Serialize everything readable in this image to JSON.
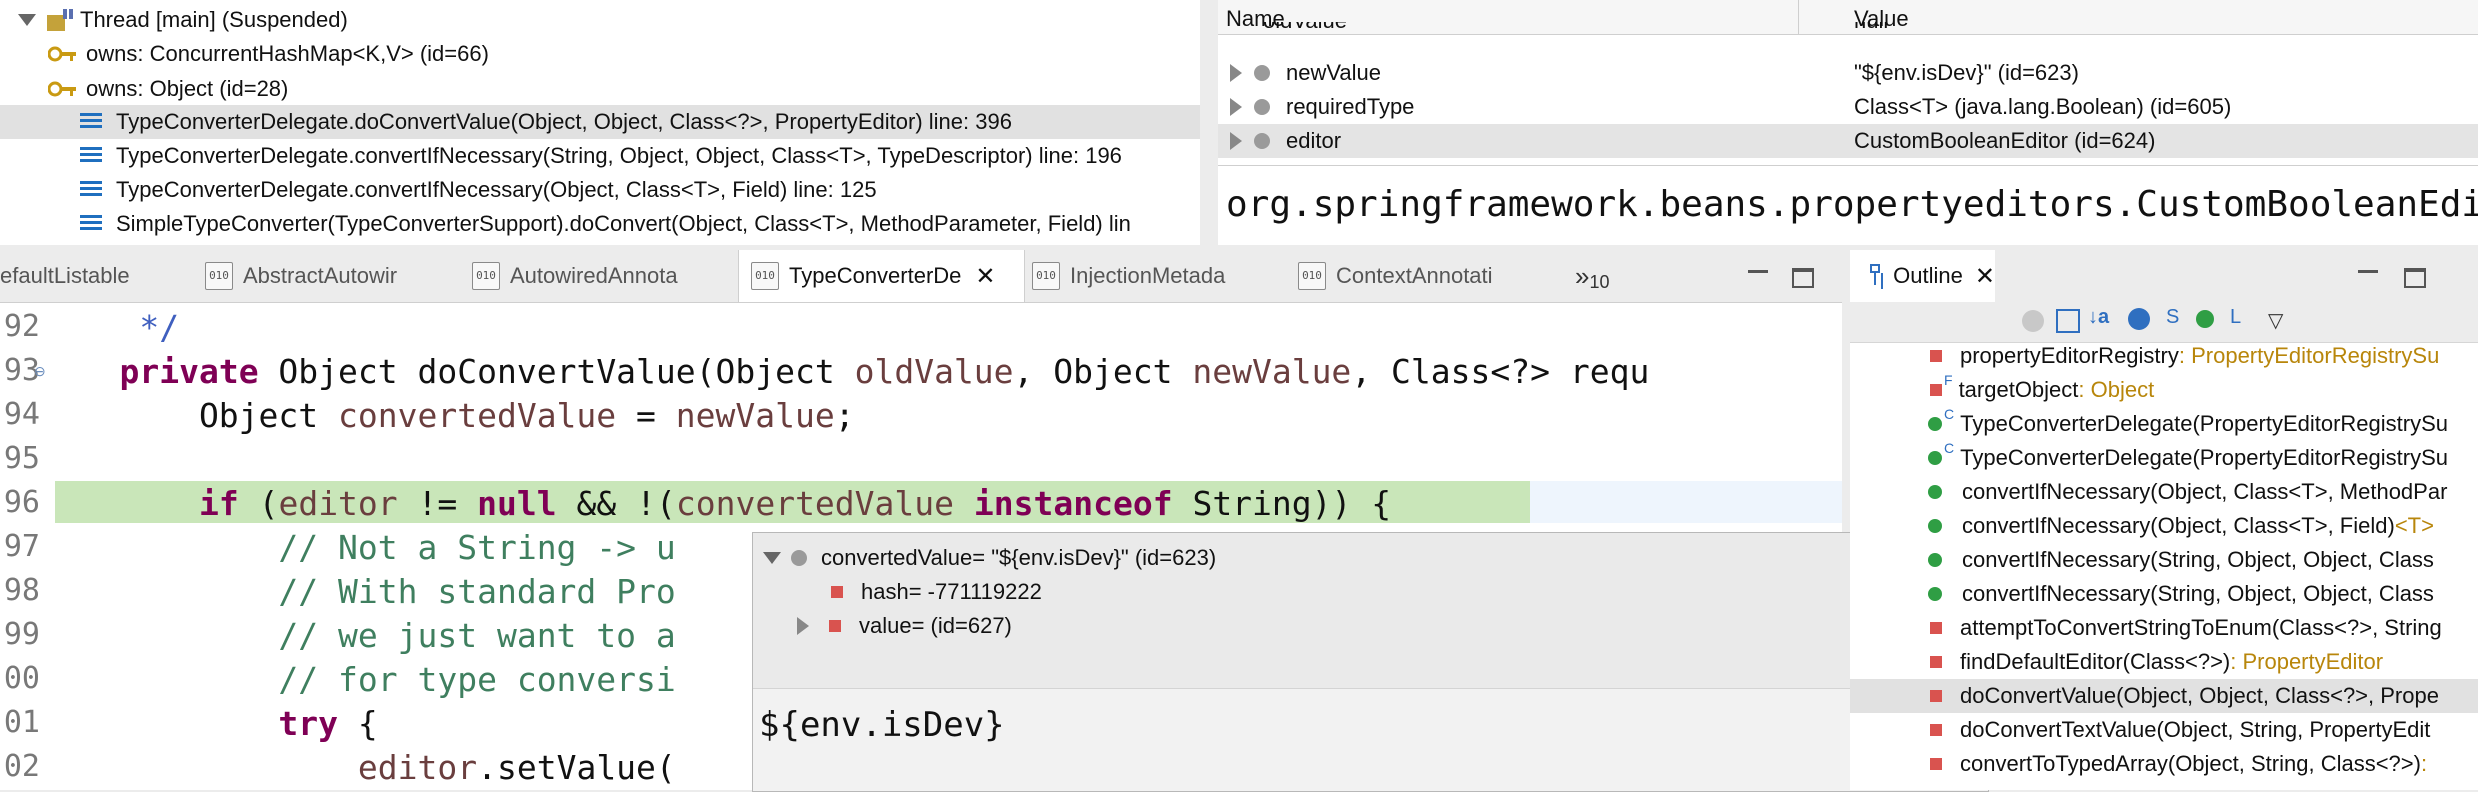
{
  "debug": {
    "thread": "Thread [main] (Suspended)",
    "locks": [
      "owns: ConcurrentHashMap<K,V>  (id=66)",
      "owns: Object  (id=28)"
    ],
    "frames": [
      "TypeConverterDelegate.doConvertValue(Object, Object, Class<?>, PropertyEditor) line: 396",
      "TypeConverterDelegate.convertIfNecessary(String, Object, Object, Class<T>, TypeDescriptor) line: 196",
      "TypeConverterDelegate.convertIfNecessary(Object, Class<T>, Field) line: 125",
      "SimpleTypeConverter(TypeConverterSupport).doConvert(Object, Class<T>, MethodParameter, Field) lin"
    ]
  },
  "variables": {
    "col_name": "Name",
    "col_value": "Value",
    "rows": [
      {
        "name": "oldValue",
        "value": "null"
      },
      {
        "name": "newValue",
        "value": "\"${env.isDev}\" (id=623)"
      },
      {
        "name": "requiredType",
        "value": "Class<T> (java.lang.Boolean) (id=605)"
      },
      {
        "name": "editor",
        "value": "CustomBooleanEditor  (id=624)"
      }
    ],
    "detail": "org.springframework.beans.propertyeditors.CustomBooleanEdi"
  },
  "tabs": {
    "items": [
      "efaultListable",
      "AbstractAutowir",
      "AutowiredAnnota",
      "TypeConverterDe",
      "InjectionMetada",
      "ContextAnnotati"
    ],
    "overflow": "10"
  },
  "editor": {
    "lines": [
      {
        "n": "92",
        "text": "     */"
      },
      {
        "n": "93",
        "text": "    private Object doConvertValue(Object oldValue, Object newValue, Class<?> requ"
      },
      {
        "n": "94",
        "text": "        Object convertedValue = newValue;"
      },
      {
        "n": "95",
        "text": ""
      },
      {
        "n": "96",
        "text": "        if (editor != null && !(convertedValue instanceof String)) {"
      },
      {
        "n": "97",
        "text": "            // Not a String -> u"
      },
      {
        "n": "98",
        "text": "            // With standard Pro"
      },
      {
        "n": "99",
        "text": "            // we just want to a"
      },
      {
        "n": "00",
        "text": "            // for type conversi"
      },
      {
        "n": "01",
        "text": "            try {"
      },
      {
        "n": "02",
        "text": "                editor.setValue("
      }
    ]
  },
  "popup": {
    "root": "convertedValue= \"${env.isDev}\" (id=623)",
    "hash": "hash= -771119222",
    "value": "value= (id=627)",
    "detail": "${env.isDev}"
  },
  "outline": {
    "title": "Outline",
    "items": [
      {
        "name": "propertyEditorRegistry",
        "type": " : PropertyEditorRegistrySu"
      },
      {
        "name": "targetObject",
        "type": " : Object"
      },
      {
        "name": "TypeConverterDelegate(PropertyEditorRegistrySu",
        "type": ""
      },
      {
        "name": "TypeConverterDelegate(PropertyEditorRegistrySu",
        "type": ""
      },
      {
        "name": "convertIfNecessary(Object, Class<T>, MethodPar",
        "type": ""
      },
      {
        "name": "convertIfNecessary(Object, Class<T>, Field)",
        "type": " <T>"
      },
      {
        "name": "convertIfNecessary(String, Object, Object, Class",
        "type": ""
      },
      {
        "name": "convertIfNecessary(String, Object, Object, Class",
        "type": ""
      },
      {
        "name": "attemptToConvertStringToEnum(Class<?>, String",
        "type": ""
      },
      {
        "name": "findDefaultEditor(Class<?>)",
        "type": " : PropertyEditor"
      },
      {
        "name": "doConvertValue(Object, Object, Class<?>, Prope",
        "type": ""
      },
      {
        "name": "doConvertTextValue(Object, String, PropertyEdit",
        "type": ""
      },
      {
        "name": "convertToTypedArray(Object, String, Class<?>)",
        "type": " :"
      }
    ]
  }
}
